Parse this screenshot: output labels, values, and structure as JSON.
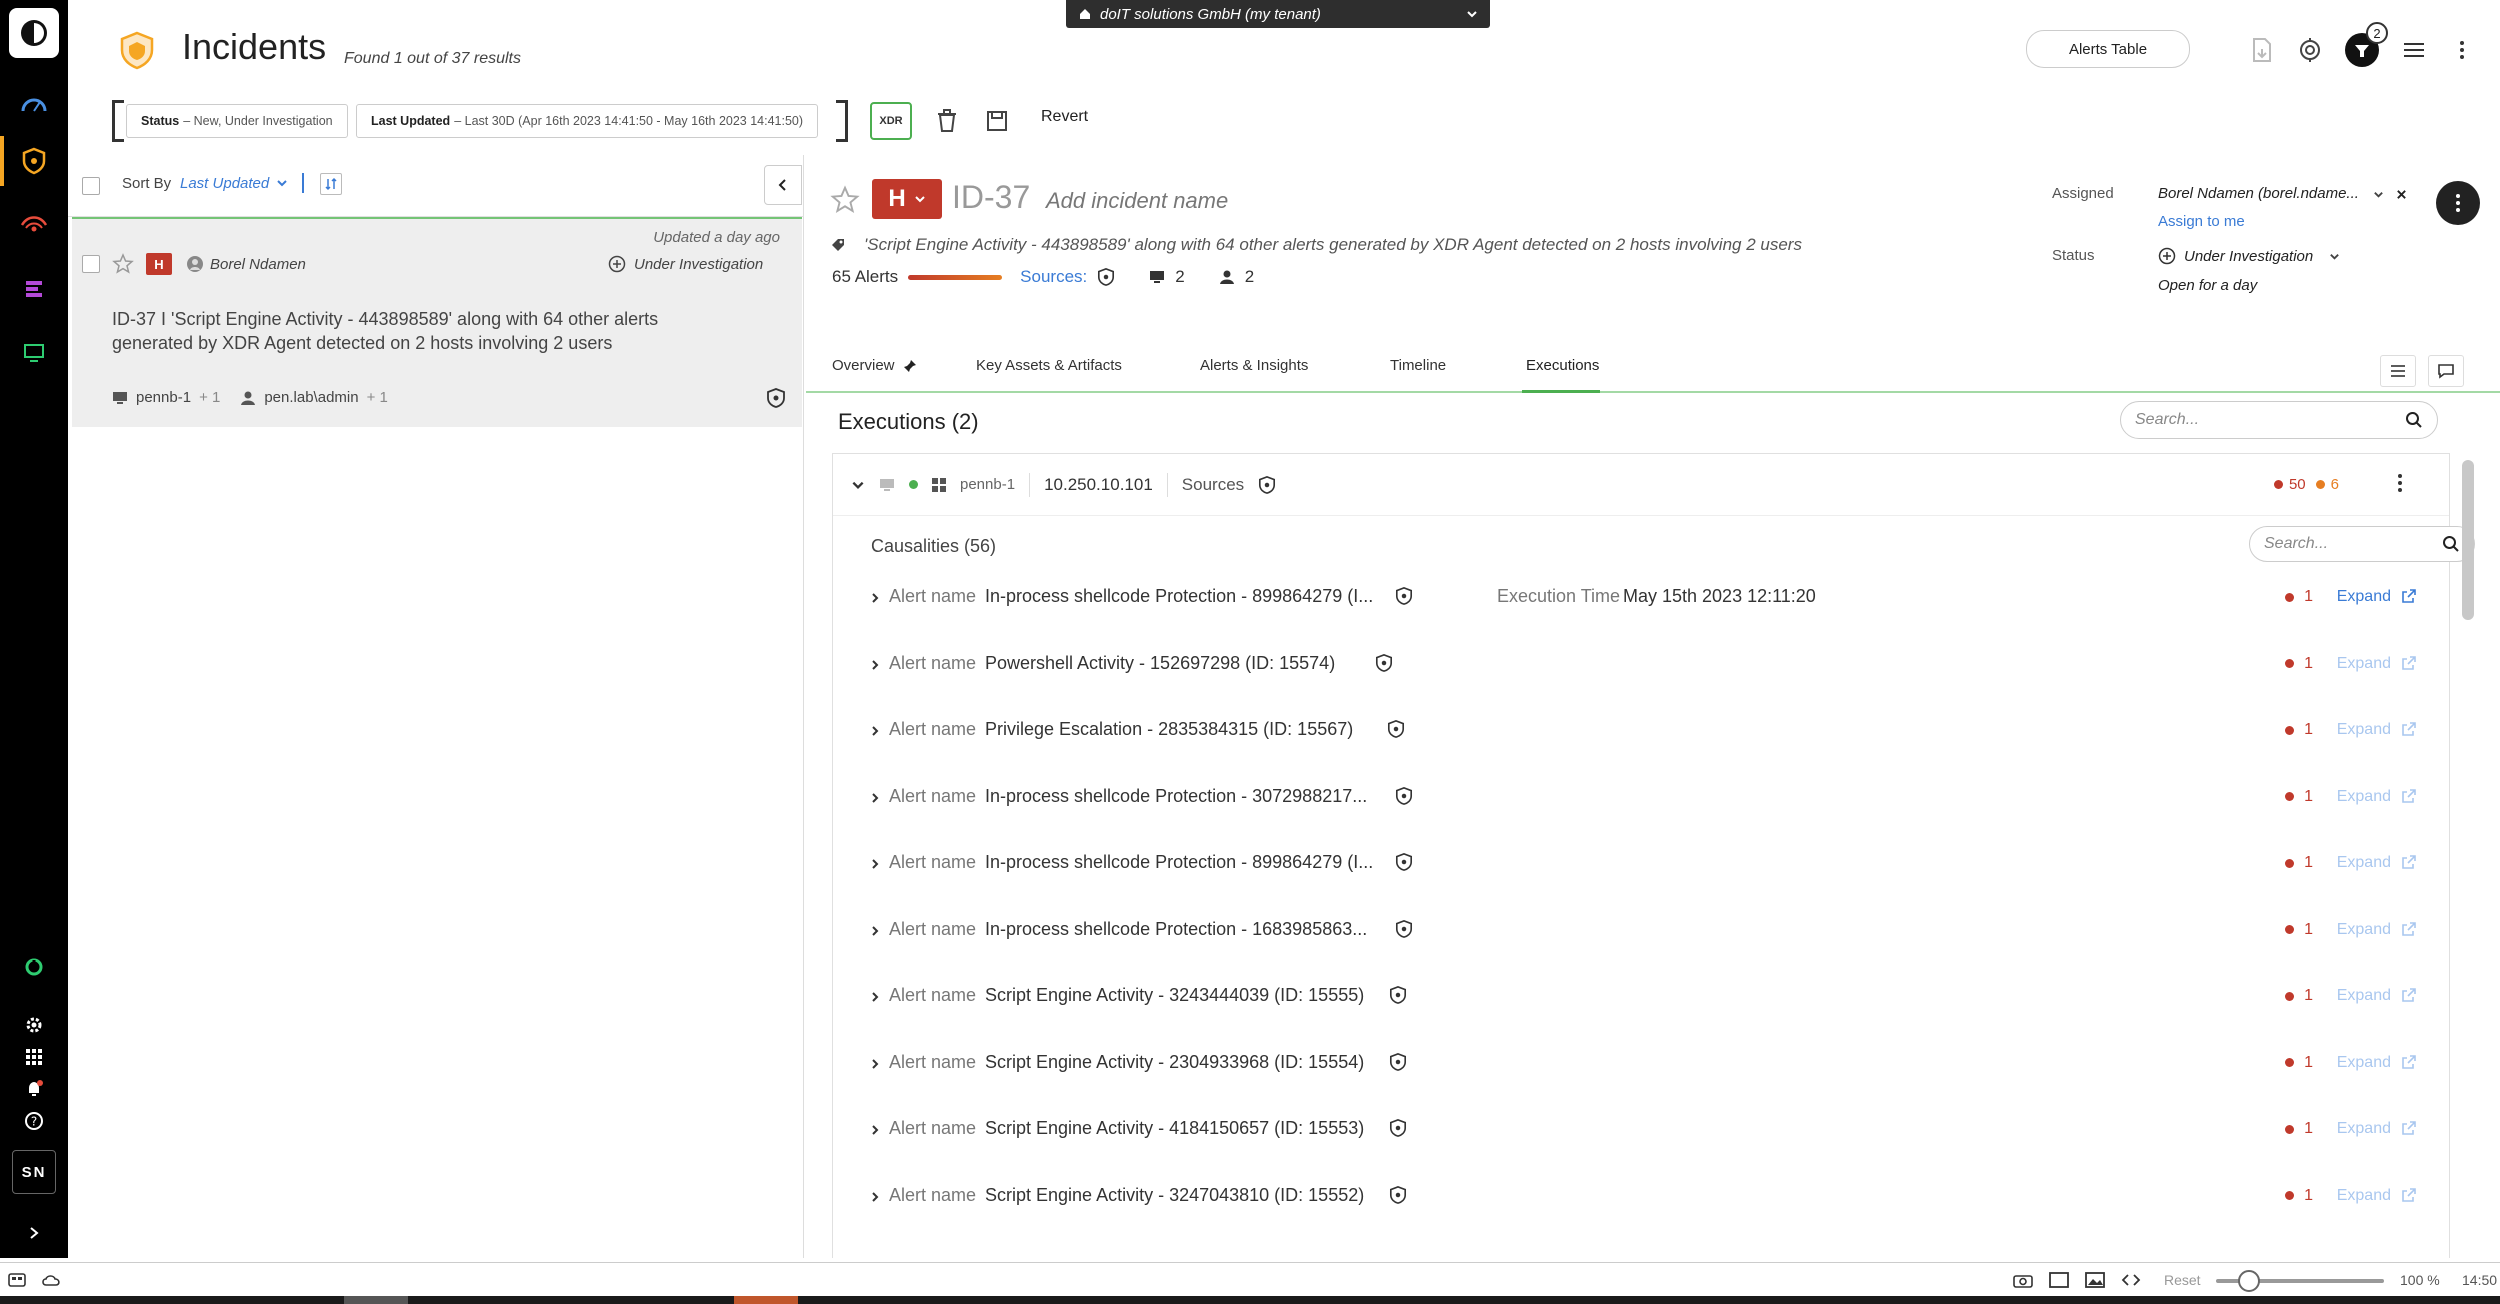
{
  "tenant": {
    "label": "doIT solutions GmbH (my tenant)"
  },
  "header": {
    "title": "Incidents",
    "subtitle": "Found 1 out of 37 results",
    "alerts_table_label": "Alerts Table",
    "notification_count": "2"
  },
  "nav": {
    "user_initials": "SN"
  },
  "filters": {
    "status_label": "Status",
    "status_value": "– New, Under Investigation",
    "updated_label": "Last Updated",
    "updated_value": "– Last 30D (Apr 16th 2023 14:41:50 - May 16th 2023 14:41:50)",
    "xdr_label": "XDR",
    "revert_label": "Revert"
  },
  "list": {
    "sort_by_label": "Sort By",
    "sort_by_value": "Last Updated",
    "card": {
      "updated": "Updated a day ago",
      "severity": "H",
      "user": "Borel Ndamen",
      "status": "Under Investigation",
      "description": "ID-37 I 'Script Engine Activity - 443898589' along with 64 other alerts generated by XDR Agent detected on 2 hosts involving 2 users",
      "host": "pennb-1",
      "host_more": "+ 1",
      "account": "pen.lab\\admin",
      "account_more": "+ 1"
    }
  },
  "detail": {
    "severity": "H",
    "id": "ID-37",
    "name_placeholder": "Add incident name",
    "description": "'Script Engine Activity - 443898589' along with 64 other alerts generated by XDR Agent detected on 2 hosts involving 2 users",
    "alerts_count": "65 Alerts",
    "sources_label": "Sources:",
    "hosts_count": "2",
    "users_count": "2",
    "assigned_label": "Assigned",
    "assigned_value": "Borel Ndamen (borel.ndame...",
    "assign_to_me": "Assign to me",
    "status_label": "Status",
    "status_value": "Under Investigation",
    "open_for": "Open for a day",
    "tabs": [
      {
        "label": "Overview"
      },
      {
        "label": "Key Assets & Artifacts"
      },
      {
        "label": "Alerts & Insights"
      },
      {
        "label": "Timeline"
      },
      {
        "label": "Executions"
      }
    ]
  },
  "executions": {
    "title": "Executions (2)",
    "search_placeholder": "Search...",
    "host": "pennb-1",
    "ip": "10.250.10.101",
    "sources_label": "Sources",
    "count_red": "50",
    "count_orange": "6",
    "causalities_title": "Causalities (56)",
    "causalities_search_placeholder": "Search...",
    "alert_name_label": "Alert name",
    "execution_time_label": "Execution Time",
    "expand_label": "Expand",
    "rows": [
      {
        "name": "In-process shellcode Protection - 899864279 (I...",
        "count": "1",
        "execution_time": "May 15th 2023 12:11:20"
      },
      {
        "name": "Powershell Activity - 152697298 (ID: 15574)",
        "count": "1"
      },
      {
        "name": "Privilege Escalation - 2835384315 (ID: 15567)",
        "count": "1"
      },
      {
        "name": "In-process shellcode Protection - 3072988217...",
        "count": "1"
      },
      {
        "name": "In-process shellcode Protection - 899864279 (I...",
        "count": "1"
      },
      {
        "name": "In-process shellcode Protection - 1683985863...",
        "count": "1"
      },
      {
        "name": "Script Engine Activity - 3243444039 (ID: 15555)",
        "count": "1"
      },
      {
        "name": "Script Engine Activity - 2304933968 (ID: 15554)",
        "count": "1"
      },
      {
        "name": "Script Engine Activity - 4184150657 (ID: 15553)",
        "count": "1"
      },
      {
        "name": "Script Engine Activity - 3247043810 (ID: 15552)",
        "count": "1"
      }
    ]
  },
  "bottombar": {
    "reset_label": "Reset",
    "zoom": "100 %",
    "time": "14:50"
  },
  "colors": {
    "severity_high": "#c0392b",
    "accent_blue": "#3a7bd5",
    "accent_green": "#4caf50",
    "nav_bg": "#000000",
    "count_orange": "#e67e22"
  }
}
